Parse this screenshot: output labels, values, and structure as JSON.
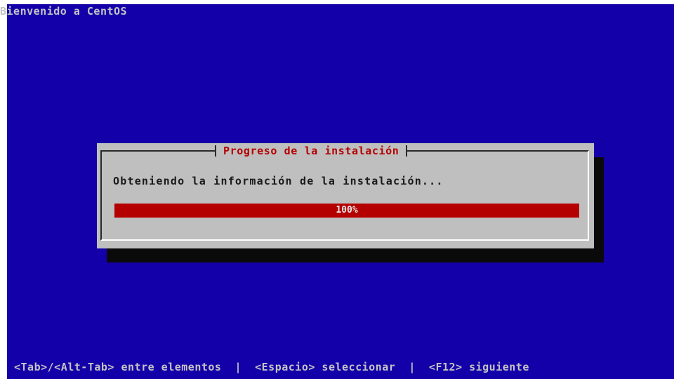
{
  "window": {
    "title": "Bienvenido a CentOS"
  },
  "dialog": {
    "title": "Progreso de la instalación",
    "message": "Obteniendo la información de la instalación...",
    "progress": {
      "value": 1.0,
      "label": "100%"
    }
  },
  "help_line": "<Tab>/<Alt-Tab> entre elementos  |  <Espacio> seleccionar  |  <F12> siguiente",
  "colors": {
    "background": "#1400a8",
    "dialog": "#bfbfbf",
    "accent": "#b40000",
    "shadow": "#0a0a0a",
    "text_light": "#c4c4c4",
    "text_dark": "#1a1a1a"
  }
}
